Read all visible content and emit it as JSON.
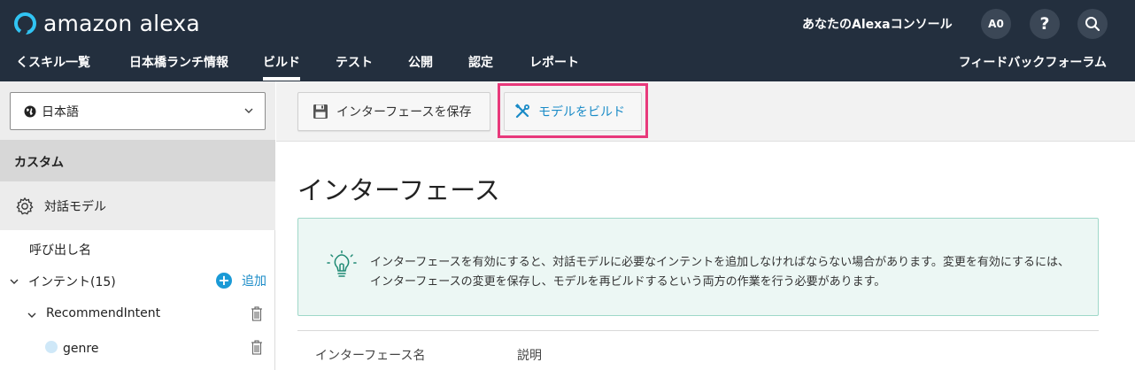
{
  "header": {
    "brand": "amazon alexa",
    "console_title": "あなたのAlexaコンソール",
    "avatar": "A0",
    "help": "?"
  },
  "nav": {
    "back_label": "くスキル一覧",
    "skill_name": "日本橋ランチ情報",
    "tabs": [
      "ビルド",
      "テスト",
      "公開",
      "認定",
      "レポート"
    ],
    "active_tab": "ビルド",
    "feedback": "フィードバックフォーラム"
  },
  "sidebar": {
    "language": "日本語",
    "section": "カスタム",
    "dialog_model": "対話モデル",
    "invocation": "呼び出し名",
    "intents_label": "インテント(15)",
    "add_label": "追加",
    "intent": "RecommendIntent",
    "slot": "genre"
  },
  "toolbar": {
    "save_label": "インターフェースを保存",
    "build_label": "モデルをビルド"
  },
  "main": {
    "title": "インターフェース",
    "info_text": "インターフェースを有効にすると、対話モデルに必要なインテントを追加しなければならない場合があります。変更を有効にするには、インターフェースの変更を保存し、モデルを再ビルドするという両方の作業を行う必要があります。",
    "col_name": "インターフェース名",
    "col_desc": "説明"
  },
  "colors": {
    "header_bg": "#232f3e",
    "accent": "#1a8bc7",
    "highlight": "#e8397b",
    "info_bg": "#ecf7f4"
  }
}
